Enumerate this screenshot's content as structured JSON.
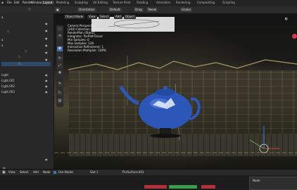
{
  "menubar": {
    "menus": [
      "File",
      "Edit",
      "Render",
      "Window",
      "Help"
    ],
    "workspaces": [
      "Layout",
      "Modeling",
      "Sculpting",
      "UV Editing",
      "Texture Paint",
      "Shading",
      "Animation",
      "Rendering",
      "Compositing",
      "Scripting"
    ],
    "active_workspace": "Layout"
  },
  "header": {
    "orientation_label": "Orientation",
    "orientation_value": "Default",
    "drag_label": "Drag",
    "drag_value": "Tweak",
    "pivot_value": "Global",
    "object_mode": "Object Mode",
    "view": "View",
    "select": "Select",
    "add": "Add",
    "object": "Object"
  },
  "viewport": {
    "overlay": [
      "Camera Perspective",
      "(240) Collection | Teapot",
      "RenderMan (Static)",
      "Integrator: PxrPathTracer",
      "Min Samples: 0",
      "Max Samples: 128",
      "Interactive Refinement: 1",
      "Resolution Multiplier: 100%"
    ]
  },
  "outliner": {
    "items": [
      "a",
      "a",
      "a",
      "",
      "",
      "",
      "Light",
      "Light.001",
      "Light.002",
      "Light.003"
    ]
  },
  "timeline": {
    "buttons": [
      "View",
      "Select",
      "Add",
      "Node",
      "Use Nodes",
      "Slot 1",
      "PxrSurface.001"
    ]
  },
  "nodepanel": {
    "title": "Node"
  },
  "colors": {
    "accent": "#4772b3",
    "teapot": "#2c56b8",
    "select_green": "#7ac25a",
    "record_red": "#e0344a"
  }
}
